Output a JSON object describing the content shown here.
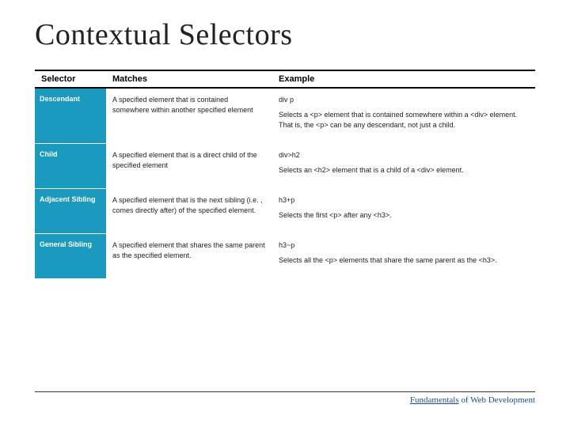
{
  "title": "Contextual Selectors",
  "columns": {
    "selector": "Selector",
    "matches": "Matches",
    "example": "Example"
  },
  "rows": [
    {
      "name": "Descendant",
      "matches": "A specified element that is contained somewhere within another specified element",
      "code": "div p",
      "desc": "Selects a <p> element that is contained somewhere within a <div> element. That is, the <p> can be any descendant, not just a child."
    },
    {
      "name": "Child",
      "matches": "A specified element that is a direct child of the specified element",
      "code": "div>h2",
      "desc": "Selects an <h2> element that is a child of a <div> element."
    },
    {
      "name": "Adjacent Sibling",
      "matches": "A specified element that is the next sibling (i.e. , comes directly after) of the specified element.",
      "code": "h3+p",
      "desc": "Selects the first <p> after any <h3>."
    },
    {
      "name": "General Sibling",
      "matches": "A specified element that shares the same parent as the specified element.",
      "code": "h3~p",
      "desc": "Selects all the <p> elements that share the same parent as the <h3>."
    }
  ],
  "footer": {
    "word1": "Fundamentals",
    "rest": " of Web Development"
  }
}
